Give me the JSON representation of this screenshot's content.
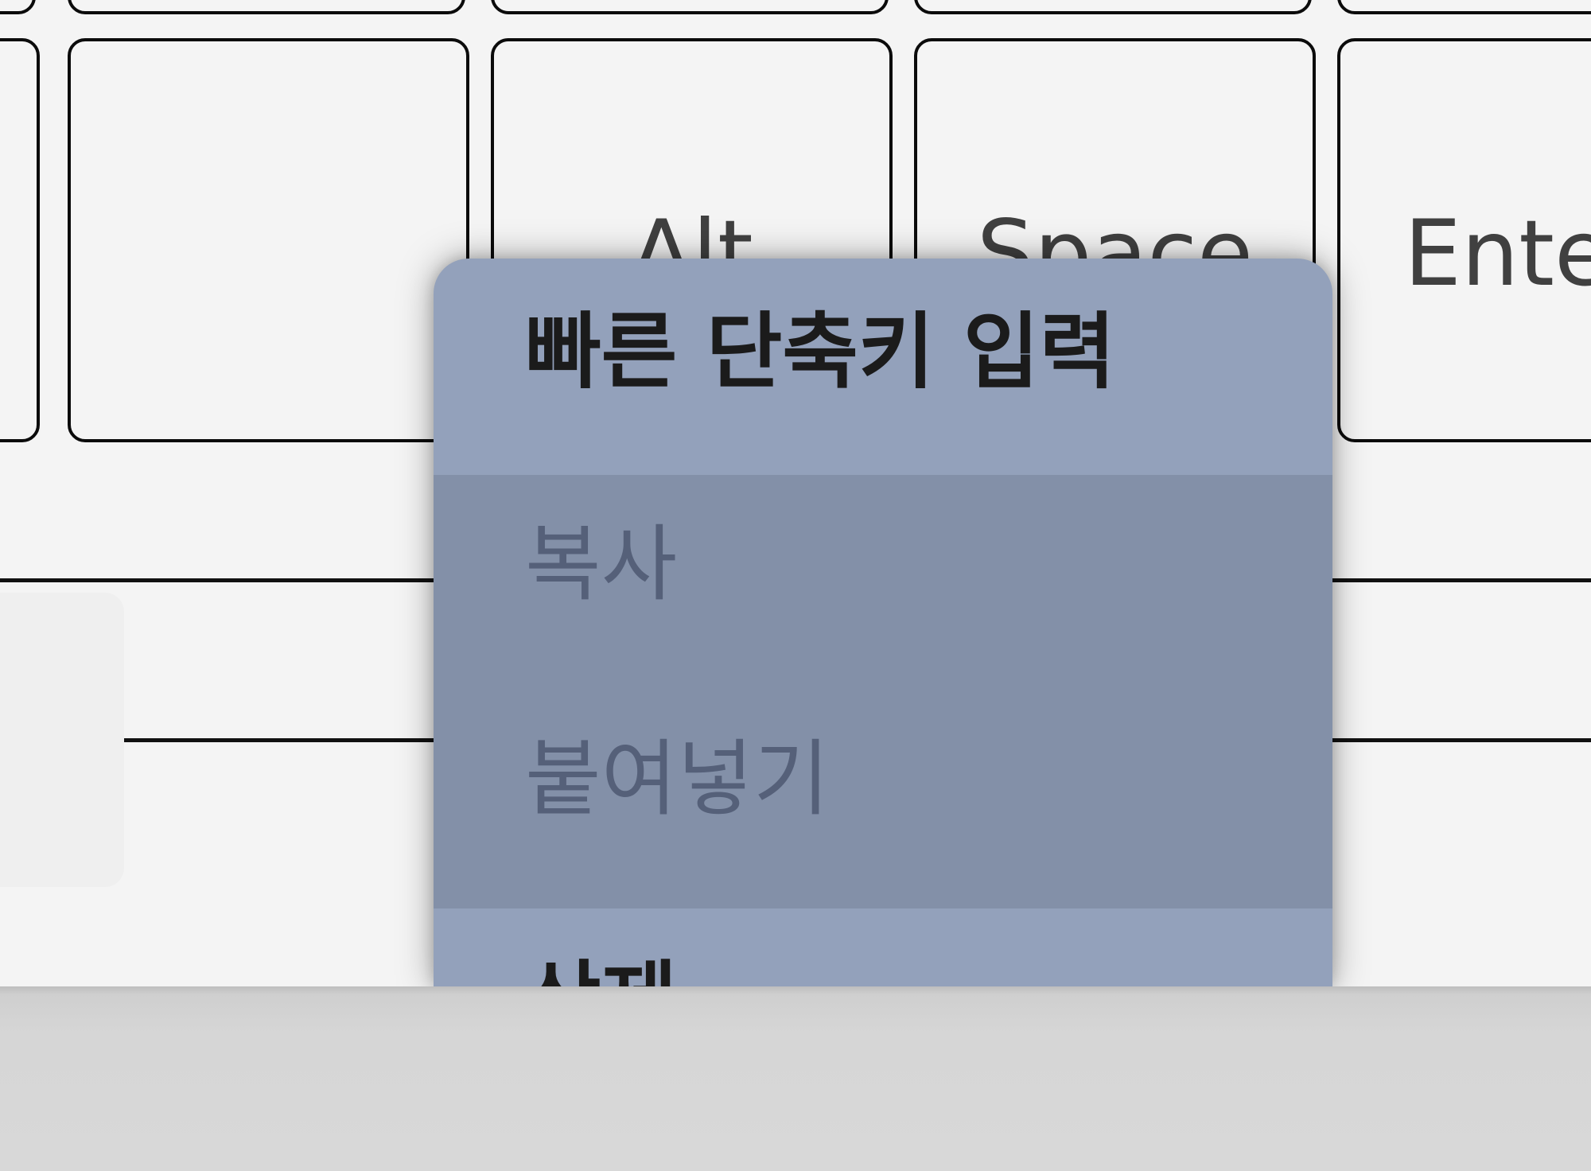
{
  "keyboard": {
    "keys": {
      "blank": "",
      "alt": "Alt",
      "space": "Space",
      "enter": "Ente"
    }
  },
  "context_menu": {
    "title": "빠른 단축키 입력",
    "items": {
      "copy": "복사",
      "paste": "붙여넣기",
      "delete": "삭제"
    }
  }
}
